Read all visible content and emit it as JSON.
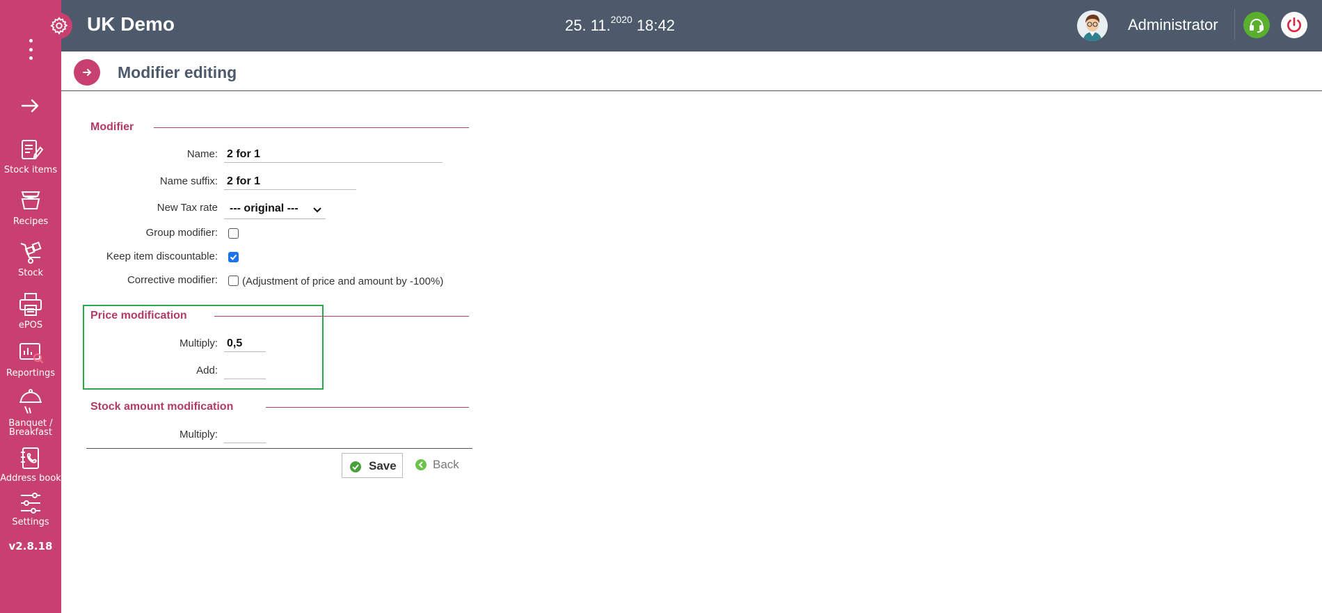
{
  "sidebar": {
    "items": [
      {
        "label": "Stock items",
        "icon": "stock-items-icon"
      },
      {
        "label": "Recipes",
        "icon": "recipes-icon"
      },
      {
        "label": "Stock",
        "icon": "stock-icon"
      },
      {
        "label": "ePOS",
        "icon": "printer-icon"
      },
      {
        "label": "Reportings",
        "icon": "reportings-icon"
      },
      {
        "label": "Banquet /",
        "label2": "Breakfast",
        "icon": "banquet-icon"
      },
      {
        "label": "Address book",
        "icon": "address-book-icon"
      },
      {
        "label": "Settings",
        "icon": "settings-sliders-icon"
      }
    ],
    "version": "v2.8.18"
  },
  "topbar": {
    "app_title": "UK Demo",
    "date": "25. 11.",
    "year": "2020",
    "time": "18:42",
    "username": "Administrator"
  },
  "page": {
    "title": "Modifier editing"
  },
  "form": {
    "modifier_section": "Modifier",
    "name_label": "Name:",
    "name_value": "2 for 1",
    "suffix_label": "Name suffix:",
    "suffix_value": "2 for 1",
    "tax_label": "New Tax rate",
    "tax_value": "--- original ---",
    "group_label": "Group modifier:",
    "group_checked": false,
    "discountable_label": "Keep item discountable:",
    "discountable_checked": true,
    "corrective_label": "Corrective modifier:",
    "corrective_checked": false,
    "corrective_note": "(Adjustment of price and amount by -100%)",
    "price_section": "Price modification",
    "price_multiply_label": "Multiply:",
    "price_multiply_value": "0,5",
    "price_add_label": "Add:",
    "price_add_value": "",
    "stock_section": "Stock amount modification",
    "stock_multiply_label": "Multiply:",
    "stock_multiply_value": ""
  },
  "buttons": {
    "save": "Save",
    "back": "Back"
  },
  "colors": {
    "sidebar": "#c8406f",
    "topbar": "#4c5a6b",
    "accent": "#b23a63",
    "highlight": "#2aa84a",
    "support": "#5ab02e"
  }
}
